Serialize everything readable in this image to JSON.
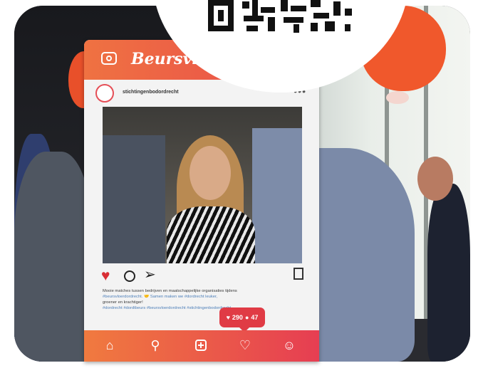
{
  "frame": {
    "brand": "Beursvloer",
    "handle": "stichtingenbodordrecht",
    "caption_line1": "Mooie matches tussen bedrijven en maatschappelijke organisaties tijdens",
    "caption_line2": "#beursvloerdordrecht. 🤝 Samen maken we #dordrecht leuker,",
    "caption_line3": "groener en krachtiger!",
    "caption_tags": "#dordrecht #dordtbeurs #beursvloerdordrecht #stichtingenbodordrecht",
    "likes": "290",
    "comments": "47",
    "more": "•••"
  },
  "colors": {
    "accent_orange": "#ef7242",
    "accent_red": "#e03b45",
    "balloon": "#f0582c"
  },
  "icons": [
    "camera-icon",
    "heart-icon",
    "comment-icon",
    "send-icon",
    "bookmark-icon",
    "home-icon",
    "search-icon",
    "add-icon",
    "heart-outline-icon",
    "profile-icon"
  ]
}
